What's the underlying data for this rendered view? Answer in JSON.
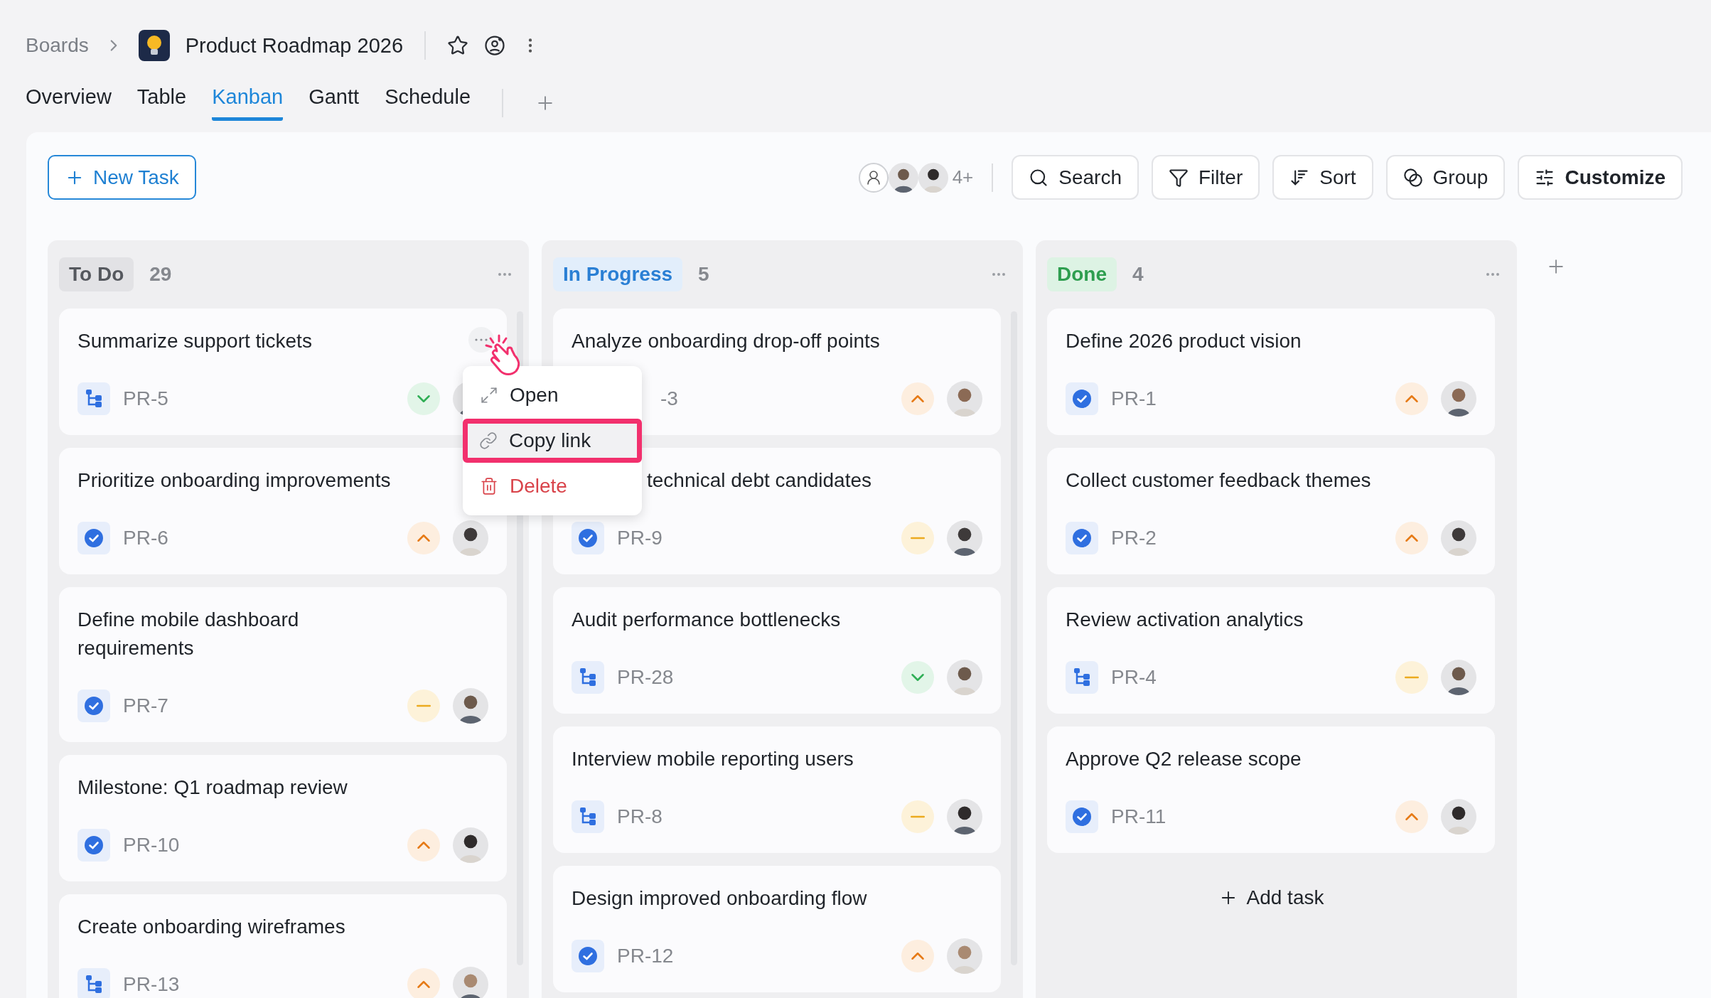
{
  "breadcrumb": {
    "root": "Boards",
    "title": "Product Roadmap 2026"
  },
  "tabs": [
    {
      "label": "Overview",
      "selected": false
    },
    {
      "label": "Table",
      "selected": false
    },
    {
      "label": "Kanban",
      "selected": true
    },
    {
      "label": "Gantt",
      "selected": false
    },
    {
      "label": "Schedule",
      "selected": false
    }
  ],
  "toolbar": {
    "new_task": "New Task",
    "member_overflow": "4+",
    "buttons": [
      {
        "kind": "search",
        "label": "Search"
      },
      {
        "kind": "filter",
        "label": "Filter"
      },
      {
        "kind": "sort",
        "label": "Sort"
      },
      {
        "kind": "group",
        "label": "Group"
      },
      {
        "kind": "customize",
        "label": "Customize"
      }
    ]
  },
  "columns": [
    {
      "name": "To Do",
      "count": "29",
      "kind": "todo",
      "cards": [
        {
          "title": "Summarize support tickets",
          "id": "PR-5",
          "kind": "subtask",
          "priority": {
            "kind": "low"
          },
          "menu_open": true
        },
        {
          "title": "Prioritize onboarding improvements",
          "id": "PR-6",
          "kind": "check",
          "priority": {
            "kind": "high"
          }
        },
        {
          "title": "Define mobile dashboard requirements",
          "id": "PR-7",
          "kind": "check",
          "priority": {
            "kind": "medium"
          }
        },
        {
          "title": "Milestone: Q1 roadmap review",
          "id": "PR-10",
          "kind": "check",
          "priority": {
            "kind": "high"
          }
        },
        {
          "title": "Create onboarding wireframes",
          "id": "PR-13",
          "kind": "subtask",
          "priority": {
            "kind": "high"
          }
        }
      ]
    },
    {
      "name": "In Progress",
      "count": "5",
      "kind": "progress",
      "cards": [
        {
          "title": "Analyze onboarding drop-off points",
          "id": "-3",
          "priority": {
            "kind": "high"
          },
          "id_covered": true
        },
        {
          "title": "technical debt candidates",
          "id": "PR-9",
          "kind": "check",
          "priority": {
            "kind": "medium"
          },
          "title_covered": true
        },
        {
          "title": "Audit performance bottlenecks",
          "id": "PR-28",
          "kind": "subtask",
          "priority": {
            "kind": "low"
          }
        },
        {
          "title": "Interview mobile reporting users",
          "id": "PR-8",
          "kind": "subtask",
          "priority": {
            "kind": "medium"
          }
        },
        {
          "title": "Design improved onboarding flow",
          "id": "PR-12",
          "kind": "check",
          "priority": {
            "kind": "high"
          }
        }
      ]
    },
    {
      "name": "Done",
      "count": "4",
      "kind": "done",
      "footer": "Add task",
      "cards": [
        {
          "title": "Define 2026 product vision",
          "id": "PR-1",
          "kind": "check",
          "priority": {
            "kind": "high"
          }
        },
        {
          "title": "Collect customer feedback themes",
          "id": "PR-2",
          "kind": "check",
          "priority": {
            "kind": "high"
          }
        },
        {
          "title": "Review activation analytics",
          "id": "PR-4",
          "kind": "subtask",
          "priority": {
            "kind": "medium"
          }
        },
        {
          "title": "Approve Q2 release scope",
          "id": "PR-11",
          "kind": "check",
          "priority": {
            "kind": "high"
          }
        }
      ]
    }
  ],
  "context_menu": {
    "items": [
      {
        "kind": "open",
        "label": "Open",
        "selected": false
      },
      {
        "kind": "link",
        "label": "Copy link",
        "selected": true
      },
      {
        "kind": "delete",
        "label": "Delete",
        "selected": false
      }
    ]
  }
}
